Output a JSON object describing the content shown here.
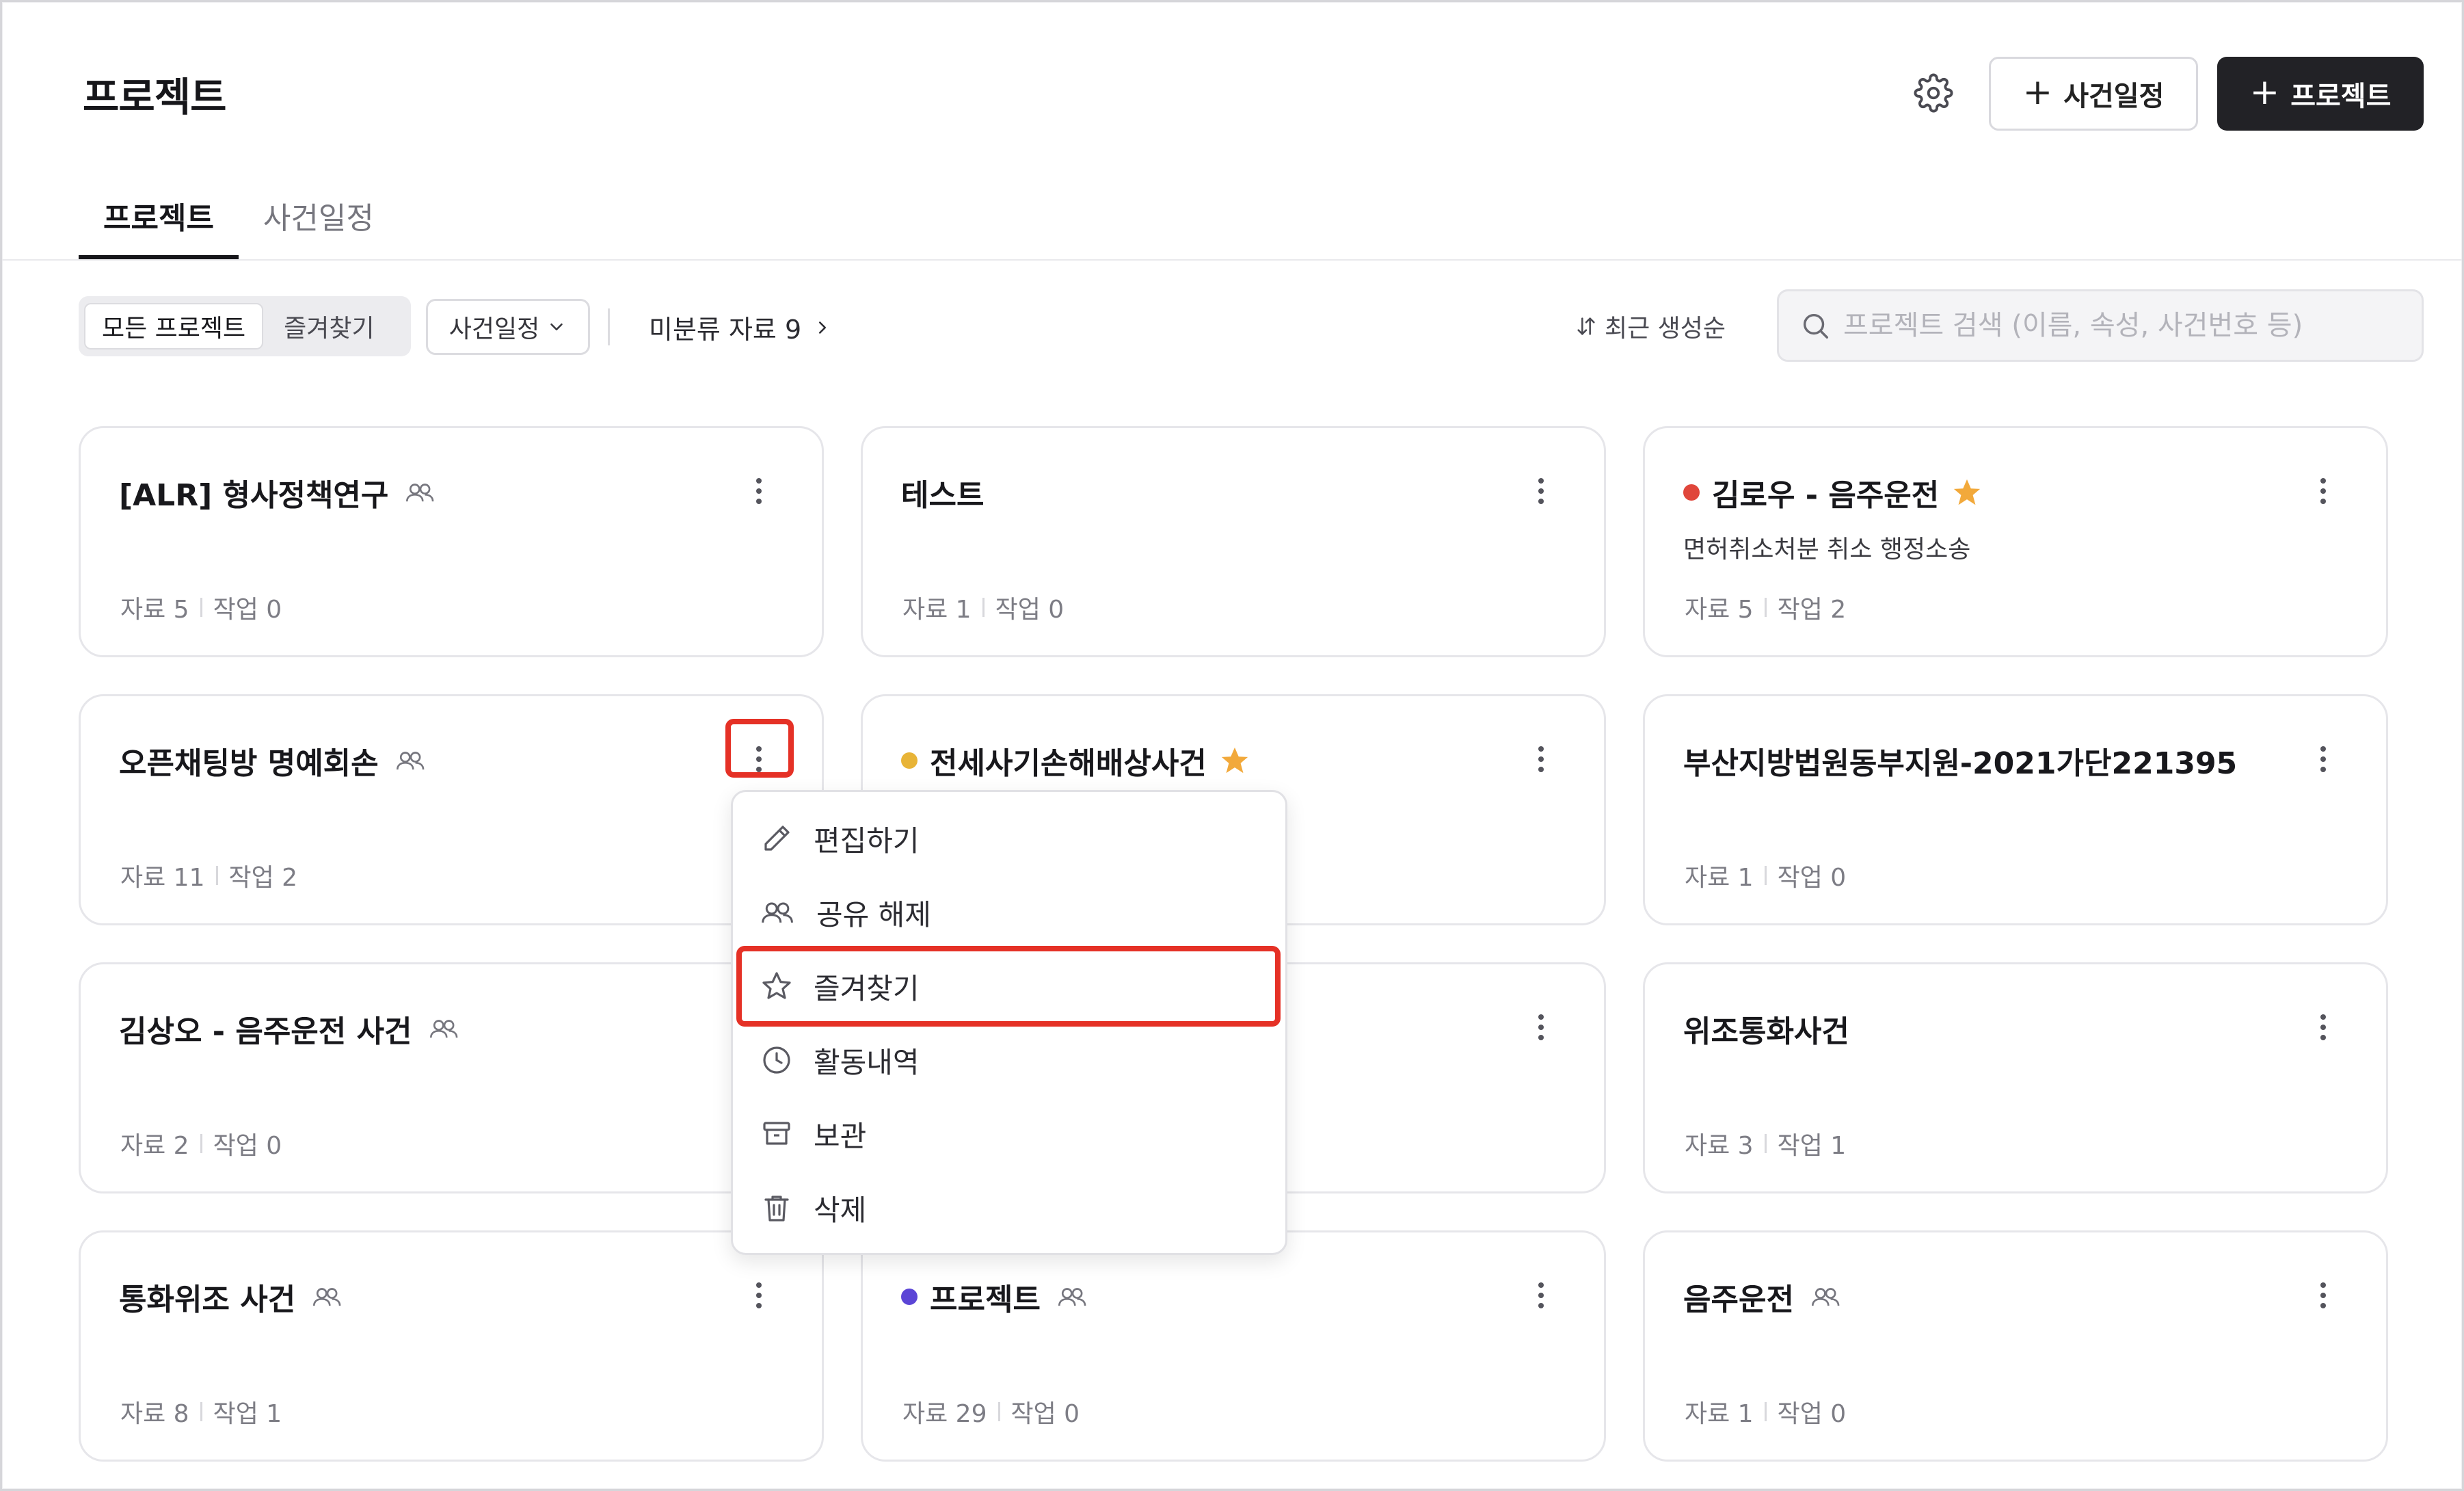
{
  "header": {
    "title": "프로젝트",
    "event_button_label": "사건일정",
    "project_button_label": "프로젝트"
  },
  "tabs": [
    {
      "label": "프로젝트",
      "active": true
    },
    {
      "label": "사건일정",
      "active": false
    }
  ],
  "filter": {
    "segments": [
      {
        "label": "모든 프로젝트",
        "active": true
      },
      {
        "label": "즐겨찾기",
        "active": false
      }
    ],
    "dropdown_label": "사건일정",
    "unsorted_label": "미분류 자료 9",
    "sort_label": "최근 생성순",
    "search_placeholder": "프로젝트 검색 (이름, 속성, 사건번호 등)"
  },
  "cards": [
    {
      "title": "[ALR] 형사정책연구",
      "shared": true,
      "dot": null,
      "star": false,
      "subtitle": "",
      "data": "자료 5",
      "tasks": "작업 0"
    },
    {
      "title": "테스트",
      "shared": false,
      "dot": null,
      "star": false,
      "subtitle": "",
      "data": "자료 1",
      "tasks": "작업 0"
    },
    {
      "title": "김로우 - 음주운전",
      "shared": false,
      "dot": "#e0463b",
      "star": true,
      "subtitle": "면허취소처분 취소 행정소송",
      "data": "자료 5",
      "tasks": "작업 2"
    },
    {
      "title": "오픈채팅방 명예회손",
      "shared": true,
      "dot": null,
      "star": false,
      "subtitle": "",
      "data": "자료 11",
      "tasks": "작업 2"
    },
    {
      "title": "전세사기손해배상사건",
      "shared": false,
      "dot": "#e8b437",
      "star": true,
      "subtitle": "",
      "data": "",
      "tasks": ""
    },
    {
      "title": "부산지방법원동부지원-2021가단221395",
      "shared": false,
      "dot": null,
      "star": false,
      "subtitle": "",
      "data": "자료 1",
      "tasks": "작업 0"
    },
    {
      "title": "김상오 - 음주운전 사건",
      "shared": true,
      "dot": null,
      "star": false,
      "subtitle": "",
      "data": "자료 2",
      "tasks": "작업 0"
    },
    {
      "title": "",
      "shared": false,
      "dot": null,
      "star": false,
      "subtitle": "",
      "data": "",
      "tasks": ""
    },
    {
      "title": "위조통화사건",
      "shared": false,
      "dot": null,
      "star": false,
      "subtitle": "",
      "data": "자료 3",
      "tasks": "작업 1"
    },
    {
      "title": "통화위조 사건",
      "shared": true,
      "dot": null,
      "star": false,
      "subtitle": "",
      "data": "자료 8",
      "tasks": "작업 1"
    },
    {
      "title": "프로젝트",
      "shared": true,
      "dot": "#5b45d6",
      "star": false,
      "subtitle": "",
      "data": "자료 29",
      "tasks": "작업 0"
    },
    {
      "title": "음주운전",
      "shared": true,
      "dot": null,
      "star": false,
      "subtitle": "",
      "data": "자료 1",
      "tasks": "작업 0"
    }
  ],
  "menu": {
    "items": [
      {
        "label": "편집하기",
        "icon": "pencil-icon"
      },
      {
        "label": "공유 해제",
        "icon": "users-icon"
      },
      {
        "label": "즐겨찾기",
        "icon": "star-icon"
      },
      {
        "label": "활동내역",
        "icon": "clock-icon"
      },
      {
        "label": "보관",
        "icon": "archive-icon"
      },
      {
        "label": "삭제",
        "icon": "trash-icon"
      }
    ]
  },
  "colors": {
    "highlight": "#e53126",
    "star": "#f2a93b",
    "primary_button": "#222226"
  }
}
